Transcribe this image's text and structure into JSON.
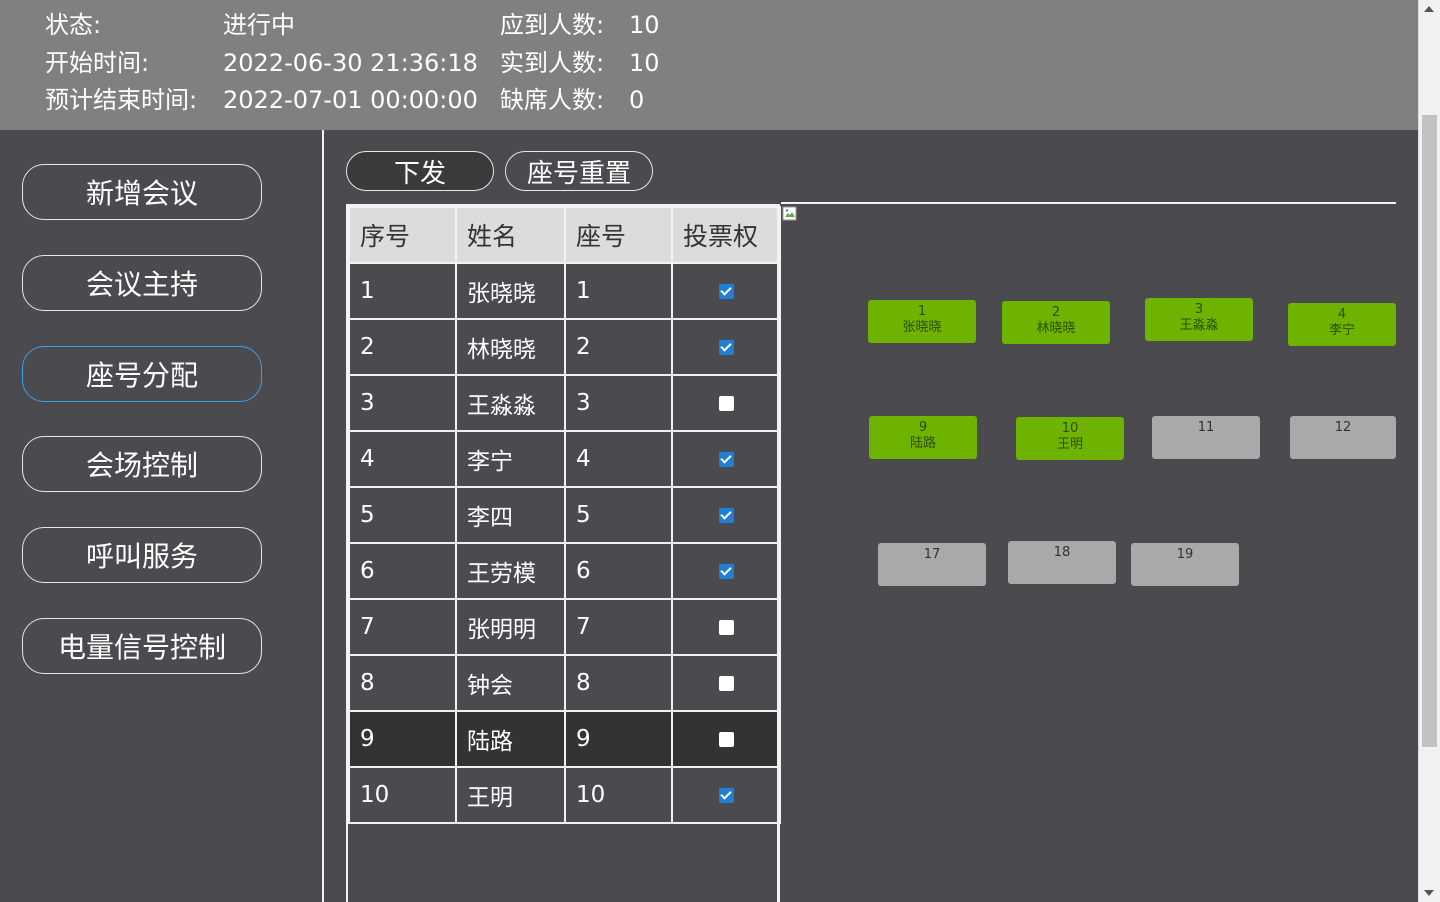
{
  "header": {
    "status_label": "状态:",
    "status_value": "进行中",
    "start_label": "开始时间:",
    "start_value": "2022-06-30 21:36:18",
    "end_label": "预计结束时间:",
    "end_value": "2022-07-01 00:00:00",
    "expected_label": "应到人数:",
    "expected_value": "10",
    "actual_label": "实到人数:",
    "actual_value": "10",
    "absent_label": "缺席人数:",
    "absent_value": "0"
  },
  "sidebar": {
    "items": [
      {
        "label": "新增会议",
        "active": false
      },
      {
        "label": "会议主持",
        "active": false
      },
      {
        "label": "座号分配",
        "active": true
      },
      {
        "label": "会场控制",
        "active": false
      },
      {
        "label": "呼叫服务",
        "active": false
      },
      {
        "label": "电量信号控制",
        "active": false
      }
    ]
  },
  "toolbar": {
    "send_label": "下发",
    "reset_label": "座号重置"
  },
  "table": {
    "headers": [
      "序号",
      "姓名",
      "座号",
      "投票权"
    ],
    "rows": [
      {
        "no": "1",
        "name": "张晓晓",
        "seat": "1",
        "vote": true
      },
      {
        "no": "2",
        "name": "林晓晓",
        "seat": "2",
        "vote": true
      },
      {
        "no": "3",
        "name": "王淼淼",
        "seat": "3",
        "vote": false
      },
      {
        "no": "4",
        "name": "李宁",
        "seat": "4",
        "vote": true
      },
      {
        "no": "5",
        "name": "李四",
        "seat": "5",
        "vote": true
      },
      {
        "no": "6",
        "name": "王劳模",
        "seat": "6",
        "vote": true
      },
      {
        "no": "7",
        "name": "张明明",
        "seat": "7",
        "vote": false
      },
      {
        "no": "8",
        "name": "钟会",
        "seat": "8",
        "vote": false
      },
      {
        "no": "9",
        "name": "陆路",
        "seat": "9",
        "vote": false,
        "selected": true
      },
      {
        "no": "10",
        "name": "王明",
        "seat": "10",
        "vote": true
      }
    ]
  },
  "seat_map": {
    "seats": [
      {
        "number": "1",
        "name": "张晓晓",
        "taken": true
      },
      {
        "number": "2",
        "name": "林晓晓",
        "taken": true
      },
      {
        "number": "3",
        "name": "王淼淼",
        "taken": true
      },
      {
        "number": "4",
        "name": "李宁",
        "taken": true
      },
      {
        "number": "9",
        "name": "陆路",
        "taken": true
      },
      {
        "number": "10",
        "name": "王明",
        "taken": true
      },
      {
        "number": "11",
        "name": "",
        "taken": false
      },
      {
        "number": "12",
        "name": "",
        "taken": false
      },
      {
        "number": "17",
        "name": "",
        "taken": false
      },
      {
        "number": "18",
        "name": "",
        "taken": false
      },
      {
        "number": "19",
        "name": "",
        "taken": false
      }
    ]
  },
  "colors": {
    "seat_taken": "#6db300",
    "seat_free": "#a9a9a9",
    "active_nav_border": "#3aa0e8",
    "checkbox_on": "#1e7fd6"
  }
}
